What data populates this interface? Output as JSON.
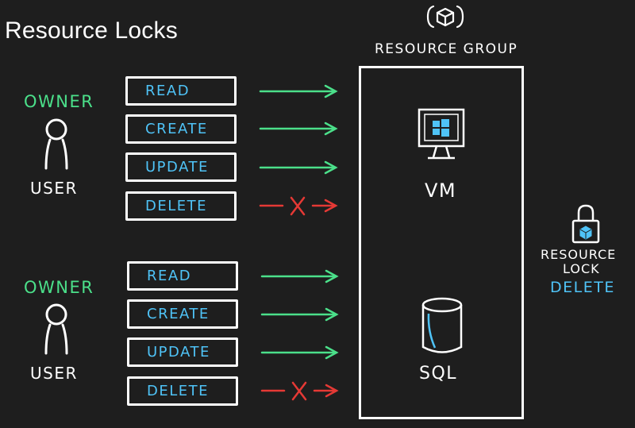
{
  "title": "Resource Locks",
  "colors": {
    "background": "#1e1e1e",
    "allowed_arrow": "#4be08a",
    "denied_arrow": "#e53935",
    "permission_text": "#4fc3f7",
    "owner_text": "#4be08a",
    "outline": "#ffffff"
  },
  "users": [
    {
      "role": "OWNER",
      "label": "USER",
      "permissions": [
        {
          "name": "READ",
          "allowed": true
        },
        {
          "name": "CREATE",
          "allowed": true
        },
        {
          "name": "UPDATE",
          "allowed": true
        },
        {
          "name": "DELETE",
          "allowed": false
        }
      ]
    },
    {
      "role": "OWNER",
      "label": "USER",
      "permissions": [
        {
          "name": "READ",
          "allowed": true
        },
        {
          "name": "CREATE",
          "allowed": true
        },
        {
          "name": "UPDATE",
          "allowed": true
        },
        {
          "name": "DELETE",
          "allowed": false
        }
      ]
    }
  ],
  "resource_group": {
    "label": "RESOURCE GROUP",
    "icon": "resource-group-cube-icon",
    "resources": [
      {
        "name": "VM",
        "icon": "monitor-windows-icon"
      },
      {
        "name": "SQL",
        "icon": "database-cylinder-icon"
      }
    ]
  },
  "lock": {
    "line1": "RESOURCE",
    "line2": "LOCK",
    "type": "DELETE",
    "icon": "padlock-cube-icon"
  }
}
